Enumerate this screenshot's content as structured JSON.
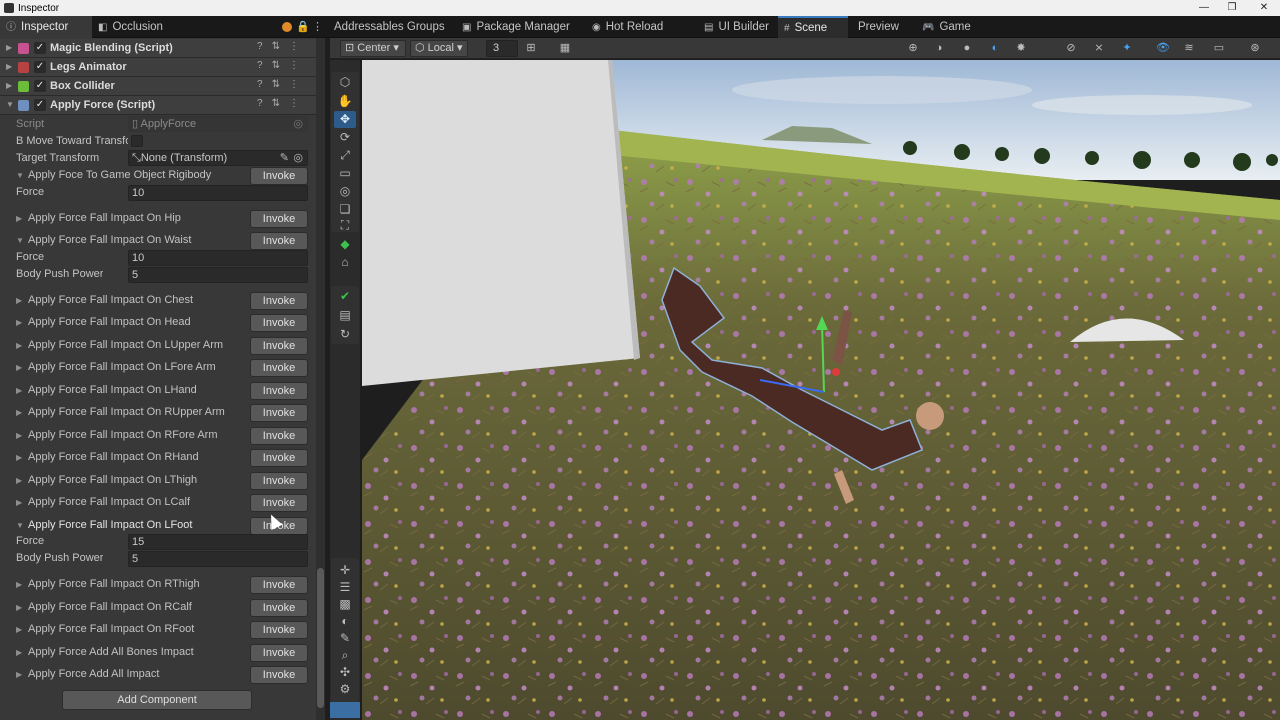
{
  "window": {
    "title": "Inspector",
    "minimize": "—",
    "restore": "❐",
    "close": "✕"
  },
  "tabs": {
    "inspector": "Inspector",
    "occlusion": "Occlusion",
    "addressables": "Addressables Groups",
    "package_manager": "Package Manager",
    "hot_reload": "Hot Reload",
    "ui_builder": "UI Builder",
    "scene": "Scene",
    "preview": "Preview",
    "game": "Game"
  },
  "inspector": {
    "components": [
      {
        "name": "Magic Blending (Script)",
        "icon_color": "#c8528f"
      },
      {
        "name": "Legs Animator",
        "icon_color": "#b84242"
      },
      {
        "name": "Box Collider",
        "icon_color": "#6bbd3a"
      },
      {
        "name": "Apply Force (Script)",
        "icon_color": "#6e8fbf"
      }
    ],
    "script_label": "Script",
    "script_value": "ApplyForce",
    "b_move_label": "B Move Toward Transfo",
    "target_transform_label": "Target Transform",
    "target_transform_value": "None (Transform)",
    "invoke_label": "Invoke",
    "force_label": "Force",
    "body_push_label": "Body Push Power",
    "events": [
      {
        "label": "Apply Foce To Game Object Rigibody",
        "expanded": true,
        "force": "10"
      },
      {
        "label": "Apply Force Fall Impact On Hip",
        "expanded": false
      },
      {
        "label": "Apply Force Fall Impact On Waist",
        "expanded": true,
        "force": "10",
        "body_push": "5"
      },
      {
        "label": "Apply Force Fall Impact On Chest",
        "expanded": false
      },
      {
        "label": "Apply Force Fall Impact On Head",
        "expanded": false
      },
      {
        "label": "Apply Force Fall Impact On LUpper Arm",
        "expanded": false
      },
      {
        "label": "Apply Force Fall Impact On LFore Arm",
        "expanded": false
      },
      {
        "label": "Apply Force Fall Impact On LHand",
        "expanded": false
      },
      {
        "label": "Apply Force Fall Impact On RUpper Arm",
        "expanded": false
      },
      {
        "label": "Apply Force Fall Impact On RFore Arm",
        "expanded": false
      },
      {
        "label": "Apply Force Fall Impact On RHand",
        "expanded": false
      },
      {
        "label": "Apply Force Fall Impact On LThigh",
        "expanded": false
      },
      {
        "label": "Apply Force Fall Impact On LCalf",
        "expanded": false
      },
      {
        "label": "Apply Force Fall Impact On LFoot",
        "expanded": true,
        "force": "15",
        "body_push": "5"
      },
      {
        "label": "Apply Force Fall Impact On RThigh",
        "expanded": false
      },
      {
        "label": "Apply Force Fall Impact On RCalf",
        "expanded": false
      },
      {
        "label": "Apply Force Fall Impact On RFoot",
        "expanded": false
      },
      {
        "label": "Apply Force Add All Bones Impact",
        "expanded": false
      },
      {
        "label": "Apply Force Add All Impact",
        "expanded": false
      }
    ],
    "add_component": "Add Component"
  },
  "scene_toolbar": {
    "pivot": "Center",
    "space": "Local",
    "grid_size": "3"
  }
}
